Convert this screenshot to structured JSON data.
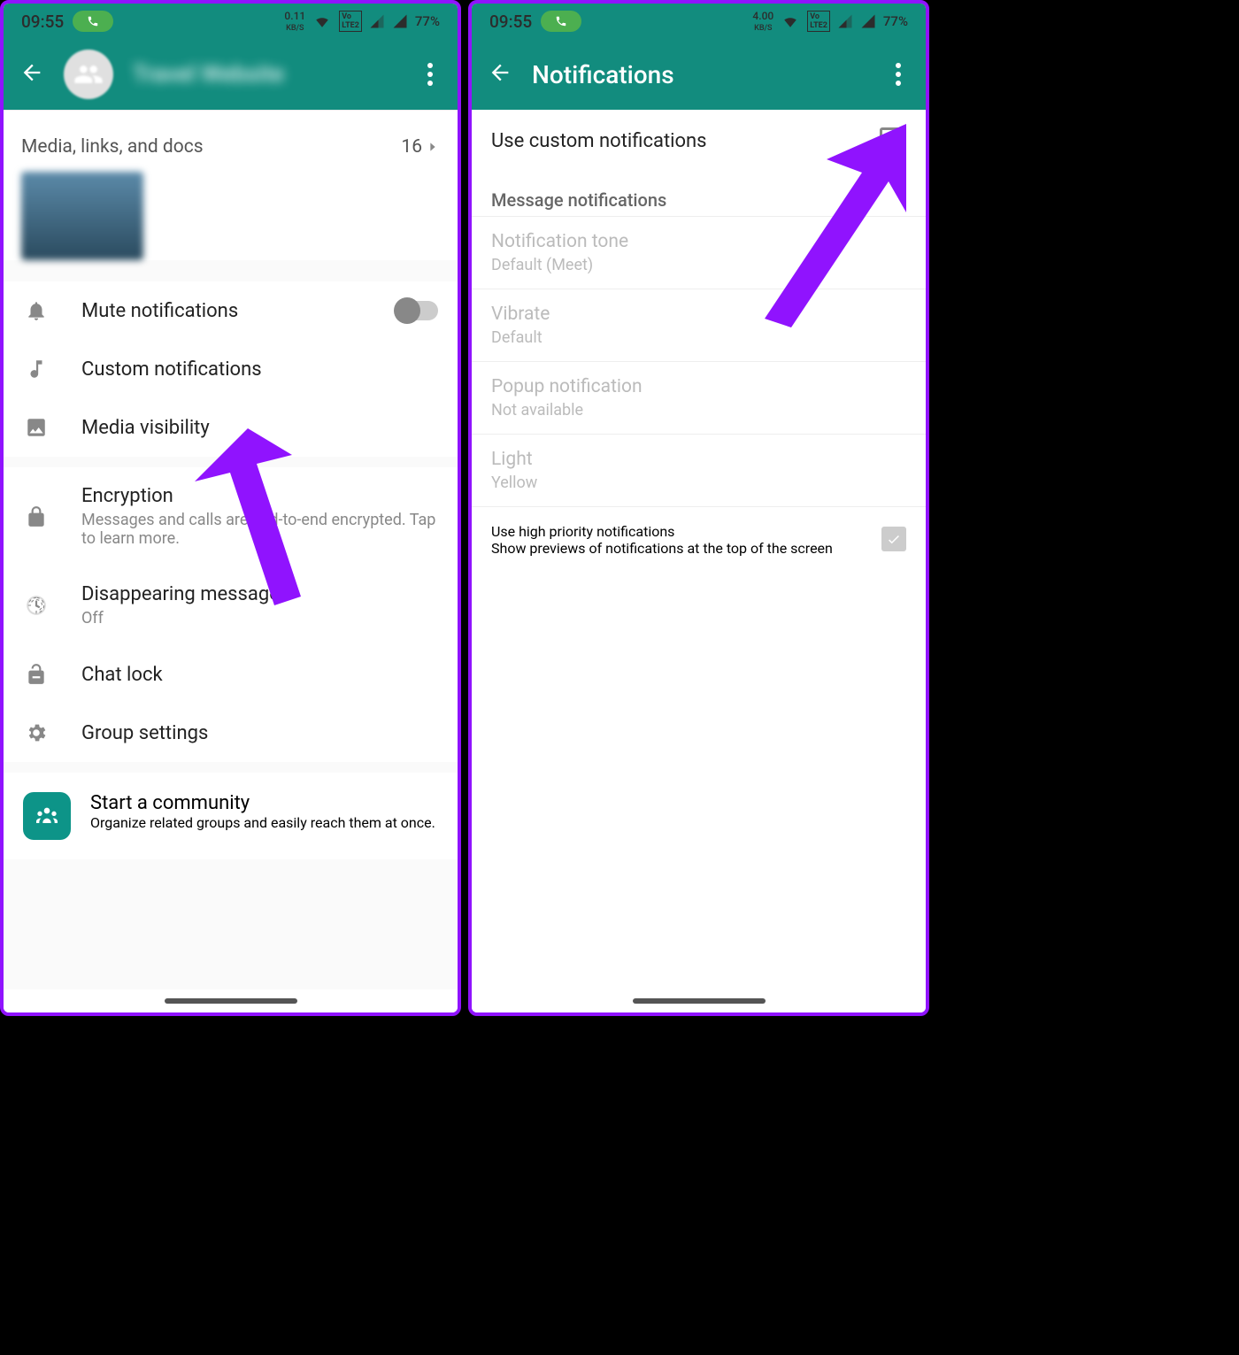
{
  "status": {
    "time": "09:55",
    "kbs1": "0.11",
    "kbs2": "4.00",
    "kbs_unit": "KB/S",
    "battery": "77%"
  },
  "left": {
    "ghost_title": "Travel Website",
    "media_label": "Media, links, and docs",
    "media_count": "16",
    "rows": {
      "mute": "Mute notifications",
      "custom": "Custom notifications",
      "media_vis": "Media visibility",
      "encryption_t": "Encryption",
      "encryption_s": "Messages and calls are end-to-end encrypted. Tap to learn more.",
      "disappear_t": "Disappearing messages",
      "disappear_s": "Off",
      "chatlock": "Chat lock",
      "group": "Group settings",
      "comm_t": "Start a community",
      "comm_s": "Organize related groups and easily reach them at once."
    }
  },
  "right": {
    "title": "Notifications",
    "use_custom": "Use custom notifications",
    "section": "Message notifications",
    "tone_t": "Notification tone",
    "tone_s": "Default (Meet)",
    "vib_t": "Vibrate",
    "vib_s": "Default",
    "popup_t": "Popup notification",
    "popup_s": "Not available",
    "light_t": "Light",
    "light_s": "Yellow",
    "hp_t": "Use high priority notifications",
    "hp_s": "Show previews of notifications at the top of the screen"
  }
}
